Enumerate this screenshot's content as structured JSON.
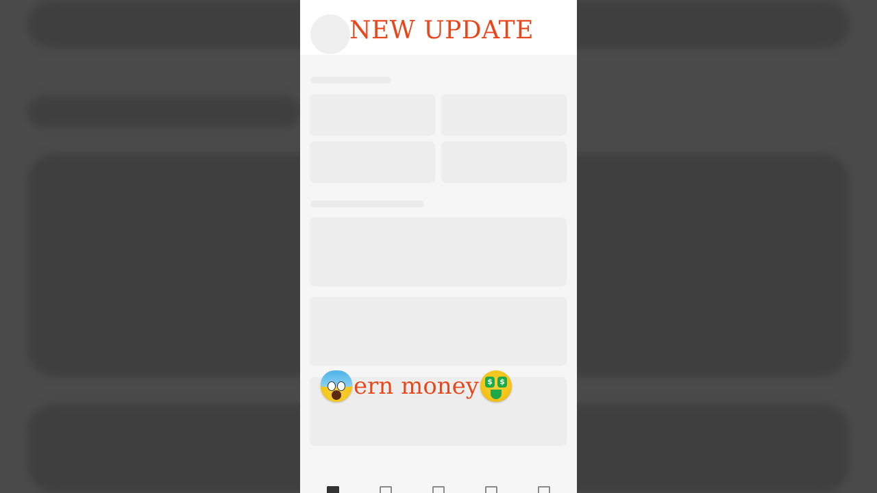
{
  "overlay": {
    "title": "NEW UPDATE",
    "caption_text": "ern money",
    "title_color": "#e8471c"
  },
  "emojis": {
    "left": "screaming-face",
    "right": "money-mouth-face"
  },
  "money_eye_symbol": "$",
  "bottom_nav": {
    "items": [
      "home-icon",
      "video-icon",
      "add-icon",
      "inbox-icon",
      "profile-icon"
    ]
  },
  "colors": {
    "backdrop": "#4b4b4b",
    "phone_background": "#f6f6f6",
    "skeleton": "#ececec"
  }
}
